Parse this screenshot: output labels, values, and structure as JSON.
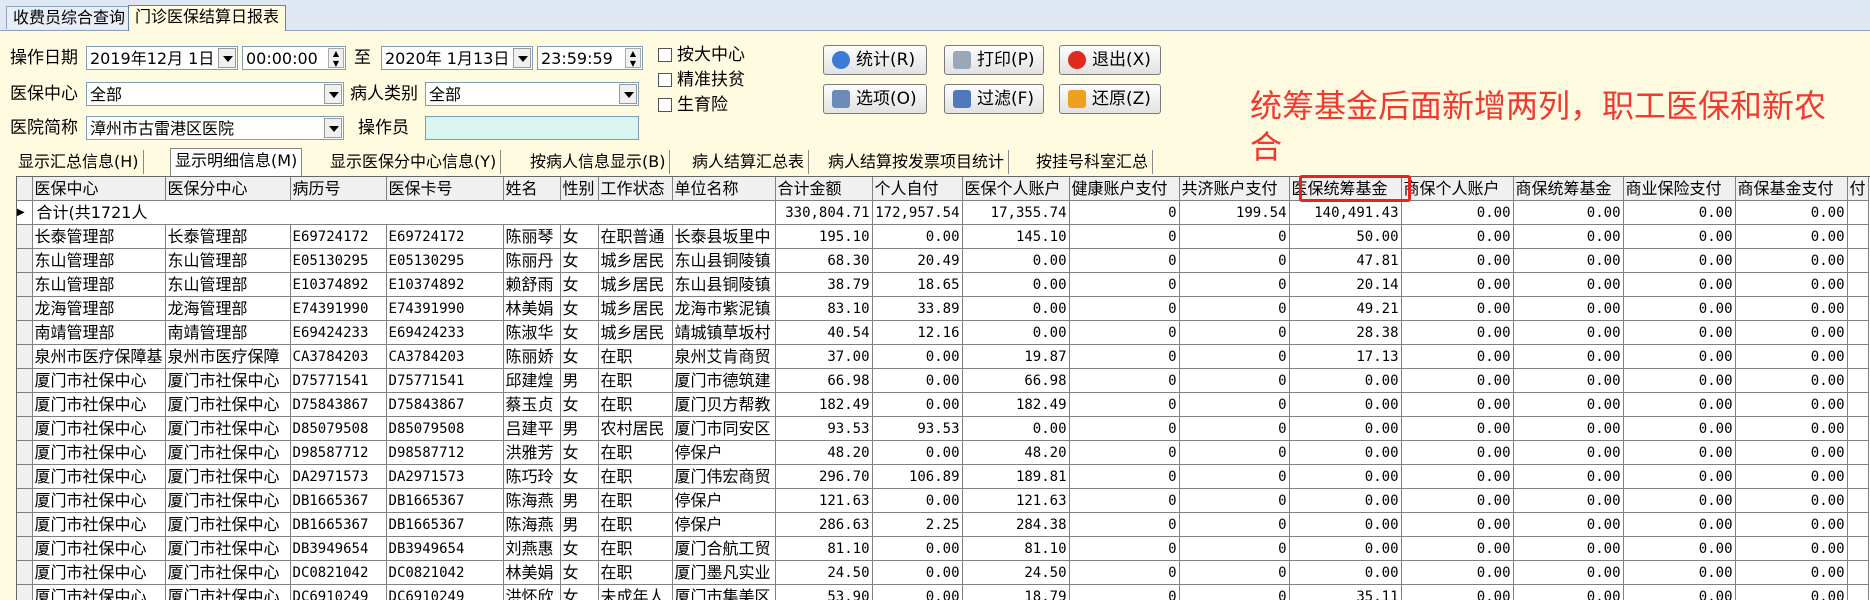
{
  "tabs": [
    "收费员综合查询",
    "门诊医保结算日报表"
  ],
  "filters": {
    "date_label": "操作日期",
    "start_date": "2019年12月 1日",
    "start_time": "00:00:00",
    "to_label": "至",
    "end_date": "2020年 1月13日",
    "end_time": "23:59:59",
    "center_label": "医保中心",
    "center_value": "全部",
    "patient_type_label": "病人类别",
    "patient_type_value": "全部",
    "hospital_label": "医院简称",
    "hospital_value": "漳州市古雷港区医院",
    "operator_label": "操作员",
    "operator_value": ""
  },
  "checkboxes": [
    "按大中心",
    "精准扶贫",
    "生育险"
  ],
  "buttons": {
    "stats": "统计(R)",
    "print": "打印(P)",
    "exit": "退出(X)",
    "options": "选项(O)",
    "filter": "过滤(F)",
    "restore": "还原(Z)"
  },
  "annotation": "统筹基金后面新增两列，职工医保和新农合",
  "view_tabs": [
    "显示汇总信息(H)",
    "显示明细信息(M)",
    "显示医保分中心信息(Y)",
    "按病人信息显示(B)",
    "病人结算汇总表",
    "病人结算按发票项目统计",
    "按挂号科室汇总"
  ],
  "columns": [
    "医保中心",
    "医保分中心",
    "病历号",
    "医保卡号",
    "姓名",
    "性别",
    "工作状态",
    "单位名称",
    "合计金额",
    "个人自付",
    "医保个人账户",
    "健康账户支付",
    "共济账户支付",
    "医保统筹基金",
    "商保个人账户",
    "商保统筹基金",
    "商业保险支付",
    "商保基金支付",
    "付"
  ],
  "total_row": {
    "label": "合计(共1721人",
    "values": [
      "330,804.71",
      "172,957.54",
      "17,355.74",
      "0",
      "199.54",
      "140,491.43",
      "0.00",
      "0.00",
      "0.00",
      "0.00"
    ]
  },
  "rows": [
    [
      "长泰管理部",
      "长泰管理部",
      "E69724172",
      "E69724172",
      "陈丽琴",
      "女",
      "在职普通",
      "长泰县坂里中",
      "195.10",
      "0.00",
      "145.10",
      "0",
      "0",
      "50.00",
      "0.00",
      "0.00",
      "0.00",
      "0.00"
    ],
    [
      "东山管理部",
      "东山管理部",
      "E05130295",
      "E05130295",
      "陈丽丹",
      "女",
      "城乡居民",
      "东山县铜陵镇",
      "68.30",
      "20.49",
      "0.00",
      "0",
      "0",
      "47.81",
      "0.00",
      "0.00",
      "0.00",
      "0.00"
    ],
    [
      "东山管理部",
      "东山管理部",
      "E10374892",
      "E10374892",
      "赖舒雨",
      "女",
      "城乡居民",
      "东山县铜陵镇",
      "38.79",
      "18.65",
      "0.00",
      "0",
      "0",
      "20.14",
      "0.00",
      "0.00",
      "0.00",
      "0.00"
    ],
    [
      "龙海管理部",
      "龙海管理部",
      "E74391990",
      "E74391990",
      "林美娟",
      "女",
      "城乡居民",
      "龙海市紫泥镇",
      "83.10",
      "33.89",
      "0.00",
      "0",
      "0",
      "49.21",
      "0.00",
      "0.00",
      "0.00",
      "0.00"
    ],
    [
      "南靖管理部",
      "南靖管理部",
      "E69424233",
      "E69424233",
      "陈淑华",
      "女",
      "城乡居民",
      "靖城镇草坂村",
      "40.54",
      "12.16",
      "0.00",
      "0",
      "0",
      "28.38",
      "0.00",
      "0.00",
      "0.00",
      "0.00"
    ],
    [
      "泉州市医疗保障基",
      "泉州市医疗保障",
      "CA3784203",
      "CA3784203",
      "陈丽娇",
      "女",
      "在职",
      "泉州艾肯商贸",
      "37.00",
      "0.00",
      "19.87",
      "0",
      "0",
      "17.13",
      "0.00",
      "0.00",
      "0.00",
      "0.00"
    ],
    [
      "厦门市社保中心",
      "厦门市社保中心",
      "D75771541",
      "D75771541",
      "邱建煌",
      "男",
      "在职",
      "厦门市德筑建",
      "66.98",
      "0.00",
      "66.98",
      "0",
      "0",
      "0.00",
      "0.00",
      "0.00",
      "0.00",
      "0.00"
    ],
    [
      "厦门市社保中心",
      "厦门市社保中心",
      "D75843867",
      "D75843867",
      "蔡玉贞",
      "女",
      "在职",
      "厦门贝方帮教",
      "182.49",
      "0.00",
      "182.49",
      "0",
      "0",
      "0.00",
      "0.00",
      "0.00",
      "0.00",
      "0.00"
    ],
    [
      "厦门市社保中心",
      "厦门市社保中心",
      "D85079508",
      "D85079508",
      "吕建平",
      "男",
      "农村居民",
      "厦门市同安区",
      "93.53",
      "93.53",
      "0.00",
      "0",
      "0",
      "0.00",
      "0.00",
      "0.00",
      "0.00",
      "0.00"
    ],
    [
      "厦门市社保中心",
      "厦门市社保中心",
      "D98587712",
      "D98587712",
      "洪雅芳",
      "女",
      "在职",
      "停保户",
      "48.20",
      "0.00",
      "48.20",
      "0",
      "0",
      "0.00",
      "0.00",
      "0.00",
      "0.00",
      "0.00"
    ],
    [
      "厦门市社保中心",
      "厦门市社保中心",
      "DA2971573",
      "DA2971573",
      "陈巧玲",
      "女",
      "在职",
      "厦门伟宏商贸",
      "296.70",
      "106.89",
      "189.81",
      "0",
      "0",
      "0.00",
      "0.00",
      "0.00",
      "0.00",
      "0.00"
    ],
    [
      "厦门市社保中心",
      "厦门市社保中心",
      "DB1665367",
      "DB1665367",
      "陈海燕",
      "男",
      "在职",
      "停保户",
      "121.63",
      "0.00",
      "121.63",
      "0",
      "0",
      "0.00",
      "0.00",
      "0.00",
      "0.00",
      "0.00"
    ],
    [
      "厦门市社保中心",
      "厦门市社保中心",
      "DB1665367",
      "DB1665367",
      "陈海燕",
      "男",
      "在职",
      "停保户",
      "286.63",
      "2.25",
      "284.38",
      "0",
      "0",
      "0.00",
      "0.00",
      "0.00",
      "0.00",
      "0.00"
    ],
    [
      "厦门市社保中心",
      "厦门市社保中心",
      "DB3949654",
      "DB3949654",
      "刘燕惠",
      "女",
      "在职",
      "厦门合航工贸",
      "81.10",
      "0.00",
      "81.10",
      "0",
      "0",
      "0.00",
      "0.00",
      "0.00",
      "0.00",
      "0.00"
    ],
    [
      "厦门市社保中心",
      "厦门市社保中心",
      "DC0821042",
      "DC0821042",
      "林美娟",
      "女",
      "在职",
      "厦门墨凡实业",
      "24.50",
      "0.00",
      "24.50",
      "0",
      "0",
      "0.00",
      "0.00",
      "0.00",
      "0.00",
      "0.00"
    ],
    [
      "厦门市社保中心",
      "厦门市社保中心",
      "DC6910249",
      "DC6910249",
      "洪怀欣",
      "女",
      "未成年人",
      "厦门市集美区",
      "53.90",
      "0.00",
      "18.79",
      "0",
      "0",
      "35.11",
      "0.00",
      "0.00",
      "0.00",
      "0.00"
    ]
  ]
}
